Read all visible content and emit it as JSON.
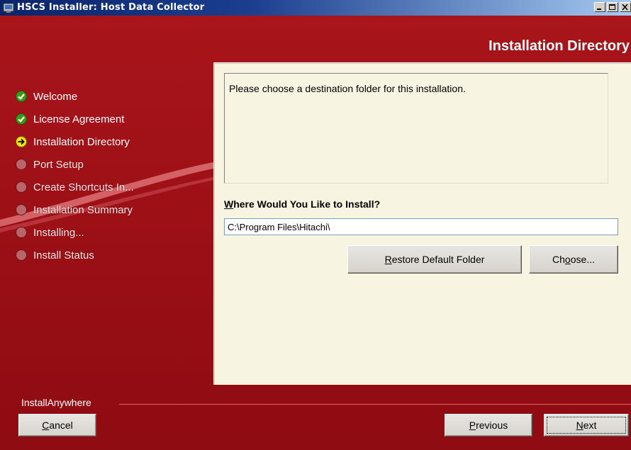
{
  "window": {
    "title": "HSCS Installer: Host Data Collector",
    "icon": "installer-app-icon"
  },
  "header": {
    "title": "Installation Directory"
  },
  "steps": [
    {
      "label": "Welcome",
      "state": "done"
    },
    {
      "label": "License Agreement",
      "state": "done"
    },
    {
      "label": "Installation Directory",
      "state": "current"
    },
    {
      "label": "Port Setup",
      "state": "pending"
    },
    {
      "label": "Create Shortcuts In...",
      "state": "pending"
    },
    {
      "label": "Installation Summary",
      "state": "pending"
    },
    {
      "label": "Installing...",
      "state": "pending"
    },
    {
      "label": "Install Status",
      "state": "pending"
    }
  ],
  "content": {
    "description": "Please choose a destination folder for this installation.",
    "where_label_mnemonic": "W",
    "where_label_rest": "here Would You Like to Install?",
    "install_path": "C:\\Program Files\\Hitachi\\",
    "restore_mnemonic": "R",
    "restore_rest": "estore Default Folder",
    "choose_pre": "Ch",
    "choose_mnemonic": "o",
    "choose_post": "ose..."
  },
  "footer": {
    "brand": "InstallAnywhere",
    "cancel_mnemonic": "C",
    "cancel_rest": "ancel",
    "previous_mnemonic": "P",
    "previous_rest": "revious",
    "next_mnemonic": "N",
    "next_rest": "ext"
  },
  "colors": {
    "background": "#9a0f15",
    "panel": "#f7f5e1",
    "done": "#3a9a16",
    "current": "#f2e30b",
    "pending": "#b9656a"
  }
}
